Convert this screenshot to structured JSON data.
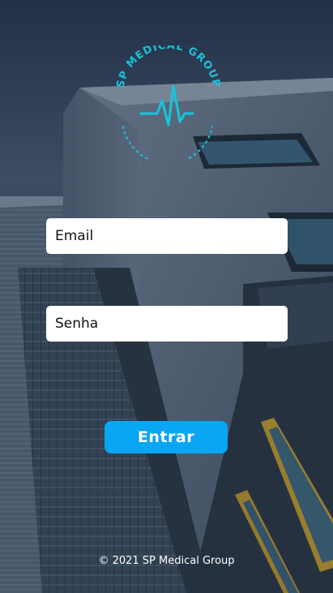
{
  "brand": {
    "name": "SP MEDICAL GROUP",
    "logo_icon": "heartbeat-icon",
    "accent_color": "#18c2d8"
  },
  "login": {
    "email_placeholder": "Email",
    "password_placeholder": "Senha",
    "submit_label": "Entrar",
    "button_color": "#09a6f3"
  },
  "footer": {
    "text": "© 2021 SP Medical Group"
  }
}
